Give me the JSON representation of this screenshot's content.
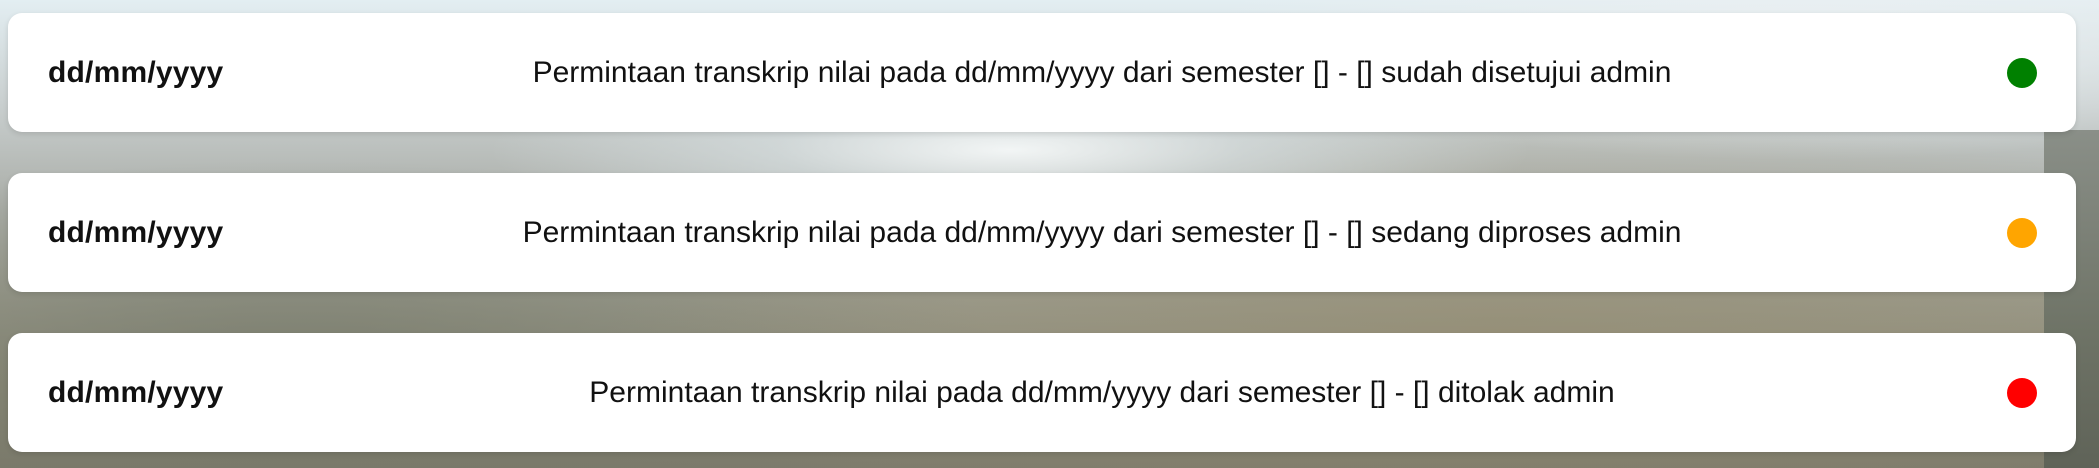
{
  "notifications": [
    {
      "date": "dd/mm/yyyy",
      "message": "Permintaan transkrip nilai pada dd/mm/yyyy dari semester [] - [] sudah disetujui admin",
      "status": "approved",
      "status_color": "#008000"
    },
    {
      "date": "dd/mm/yyyy",
      "message": "Permintaan transkrip nilai pada dd/mm/yyyy dari semester [] - [] sedang diproses admin",
      "status": "processing",
      "status_color": "#FFA500"
    },
    {
      "date": "dd/mm/yyyy",
      "message": "Permintaan transkrip nilai pada dd/mm/yyyy dari semester [] - [] ditolak admin",
      "status": "rejected",
      "status_color": "#FF0000"
    }
  ]
}
